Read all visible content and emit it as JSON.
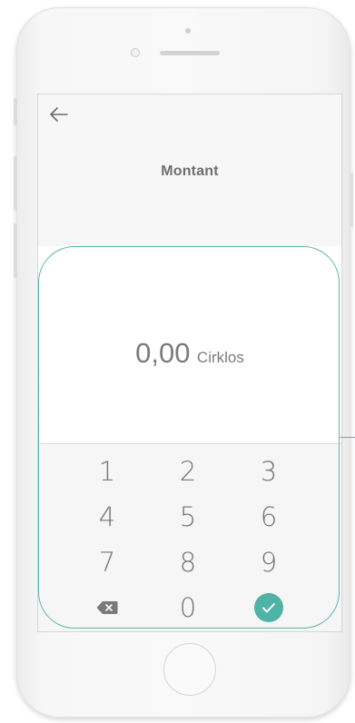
{
  "header": {
    "title": "Montant"
  },
  "amount": {
    "value": "0,00",
    "unit": "Cirklos"
  },
  "keypad": {
    "keys": [
      "1",
      "2",
      "3",
      "4",
      "5",
      "6",
      "7",
      "8",
      "9",
      "0"
    ],
    "delete_icon": "backspace-icon",
    "confirm_icon": "check-icon"
  },
  "colors": {
    "accent": "#4fb3a5",
    "text": "#757575"
  }
}
